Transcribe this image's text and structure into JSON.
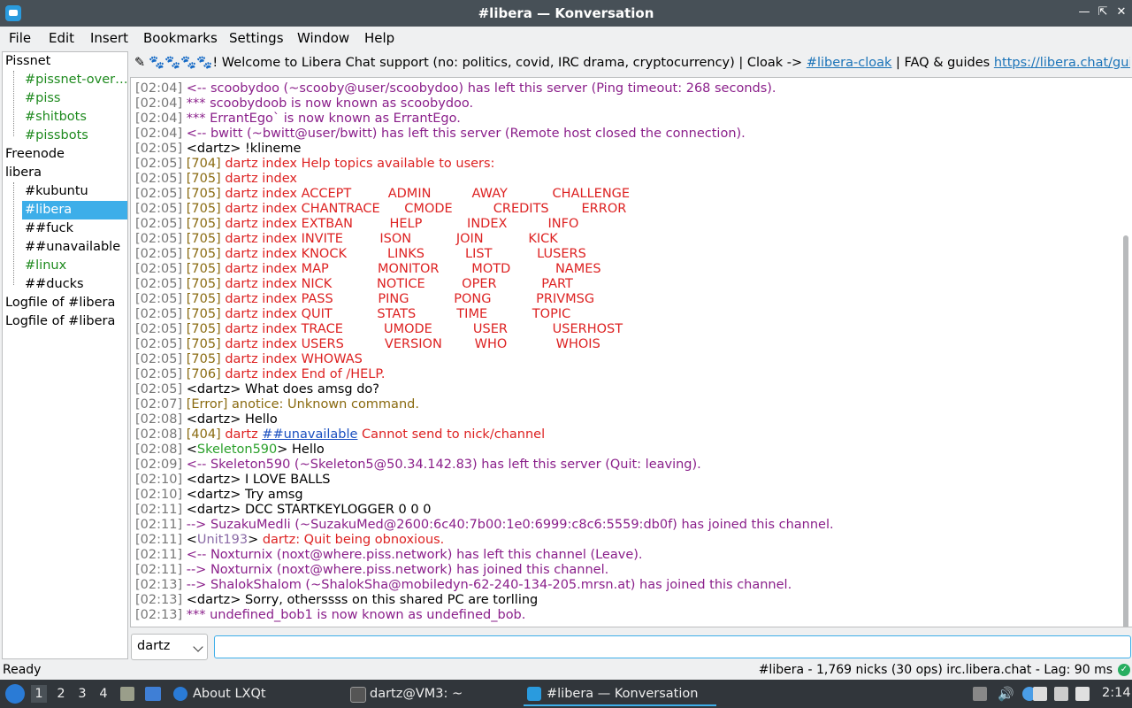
{
  "window": {
    "title": "#libera — Konversation",
    "controls": [
      "minimize-icon",
      "maximize-icon",
      "close-icon"
    ]
  },
  "menu": [
    "File",
    "Edit",
    "Insert",
    "Bookmarks",
    "Settings",
    "Window",
    "Help"
  ],
  "tree": {
    "items": [
      {
        "label": "Pissnet",
        "level": 0,
        "color": "black"
      },
      {
        "label": "#pissnet-overflow",
        "level": 1,
        "color": "green"
      },
      {
        "label": "#piss",
        "level": 1,
        "color": "green"
      },
      {
        "label": "#shitbots",
        "level": 1,
        "color": "green"
      },
      {
        "label": "#pissbots",
        "level": 1,
        "color": "green"
      },
      {
        "label": "Freenode",
        "level": 0,
        "color": "black"
      },
      {
        "label": "libera",
        "level": 0,
        "color": "black"
      },
      {
        "label": "#kubuntu",
        "level": 1,
        "color": "black"
      },
      {
        "label": "#libera",
        "level": 1,
        "color": "selected"
      },
      {
        "label": "##fuck",
        "level": 1,
        "color": "black"
      },
      {
        "label": "##unavailable",
        "level": 1,
        "color": "black"
      },
      {
        "label": "#linux",
        "level": 1,
        "color": "green"
      },
      {
        "label": "##ducks",
        "level": 1,
        "color": "black"
      },
      {
        "label": "Logfile of #libera",
        "level": 0,
        "color": "black"
      },
      {
        "label": "Logfile of #libera",
        "level": 0,
        "color": "black"
      }
    ]
  },
  "topic": {
    "emoji": "🐾🐾🐾🐾",
    "text_before": "! Welcome to Libera Chat support (no: politics, covid, IRC drama, cryptocurrency) | Cloak -> ",
    "link1": "#libera-cloak",
    "text_mid": " | FAQ & guides ",
    "link2": "https://libera.chat/guides/fa..."
  },
  "chat": [
    {
      "ts": "[02:04]",
      "segs": [
        {
          "t": "<-- scoobydoo (~scooby@user/scoobydoo) has left this server (Ping timeout: 268 seconds).",
          "c": "purple"
        }
      ]
    },
    {
      "ts": "[02:04]",
      "segs": [
        {
          "t": "*** scoobydoob is now known as scoobydoo.",
          "c": "purple"
        }
      ]
    },
    {
      "ts": "[02:04]",
      "segs": [
        {
          "t": "*** ErrantEgo` is now known as ErrantEgo.",
          "c": "purple"
        }
      ]
    },
    {
      "ts": "[02:04]",
      "segs": [
        {
          "t": "<-- bwitt (~bwitt@user/bwitt) has left this server (Remote host closed the connection).",
          "c": "purple"
        }
      ]
    },
    {
      "ts": "[02:05]",
      "segs": [
        {
          "t": "<dartz> !klineme",
          "c": "plain"
        }
      ]
    },
    {
      "ts": "[02:05]",
      "segs": [
        {
          "t": "[704]",
          "c": "brown"
        },
        {
          "t": " dartz index Help topics available to users:",
          "c": "red"
        }
      ]
    },
    {
      "ts": "[02:05]",
      "segs": [
        {
          "t": "[705]",
          "c": "brown"
        },
        {
          "t": " dartz index",
          "c": "red"
        }
      ]
    },
    {
      "ts": "[02:05]",
      "segs": [
        {
          "t": "[705]",
          "c": "brown"
        },
        {
          "t": " dartz index ACCEPT         ADMIN          AWAY           CHALLENGE",
          "c": "red"
        }
      ]
    },
    {
      "ts": "[02:05]",
      "segs": [
        {
          "t": "[705]",
          "c": "brown"
        },
        {
          "t": " dartz index CHANTRACE      CMODE          CREDITS        ERROR",
          "c": "red"
        }
      ]
    },
    {
      "ts": "[02:05]",
      "segs": [
        {
          "t": "[705]",
          "c": "brown"
        },
        {
          "t": " dartz index EXTBAN         HELP           INDEX          INFO",
          "c": "red"
        }
      ]
    },
    {
      "ts": "[02:05]",
      "segs": [
        {
          "t": "[705]",
          "c": "brown"
        },
        {
          "t": " dartz index INVITE         ISON           JOIN           KICK",
          "c": "red"
        }
      ]
    },
    {
      "ts": "[02:05]",
      "segs": [
        {
          "t": "[705]",
          "c": "brown"
        },
        {
          "t": " dartz index KNOCK          LINKS          LIST           LUSERS",
          "c": "red"
        }
      ]
    },
    {
      "ts": "[02:05]",
      "segs": [
        {
          "t": "[705]",
          "c": "brown"
        },
        {
          "t": " dartz index MAP            MONITOR        MOTD           NAMES",
          "c": "red"
        }
      ]
    },
    {
      "ts": "[02:05]",
      "segs": [
        {
          "t": "[705]",
          "c": "brown"
        },
        {
          "t": " dartz index NICK           NOTICE         OPER           PART",
          "c": "red"
        }
      ]
    },
    {
      "ts": "[02:05]",
      "segs": [
        {
          "t": "[705]",
          "c": "brown"
        },
        {
          "t": " dartz index PASS           PING           PONG           PRIVMSG",
          "c": "red"
        }
      ]
    },
    {
      "ts": "[02:05]",
      "segs": [
        {
          "t": "[705]",
          "c": "brown"
        },
        {
          "t": " dartz index QUIT           STATS          TIME           TOPIC",
          "c": "red"
        }
      ]
    },
    {
      "ts": "[02:05]",
      "segs": [
        {
          "t": "[705]",
          "c": "brown"
        },
        {
          "t": " dartz index TRACE          UMODE          USER           USERHOST",
          "c": "red"
        }
      ]
    },
    {
      "ts": "[02:05]",
      "segs": [
        {
          "t": "[705]",
          "c": "brown"
        },
        {
          "t": " dartz index USERS          VERSION        WHO            WHOIS",
          "c": "red"
        }
      ]
    },
    {
      "ts": "[02:05]",
      "segs": [
        {
          "t": "[705]",
          "c": "brown"
        },
        {
          "t": " dartz index WHOWAS",
          "c": "red"
        }
      ]
    },
    {
      "ts": "[02:05]",
      "segs": [
        {
          "t": "[706]",
          "c": "brown"
        },
        {
          "t": " dartz index End of /HELP.",
          "c": "red"
        }
      ]
    },
    {
      "ts": "[02:05]",
      "segs": [
        {
          "t": "<dartz> What does amsg do?",
          "c": "plain"
        }
      ]
    },
    {
      "ts": "[02:07]",
      "segs": [
        {
          "t": "[Error]",
          "c": "brown"
        },
        {
          "t": " anotice: Unknown command.",
          "c": "brown"
        }
      ]
    },
    {
      "ts": "[02:08]",
      "segs": [
        {
          "t": "<dartz> Hello",
          "c": "plain"
        }
      ]
    },
    {
      "ts": "[02:08]",
      "segs": [
        {
          "t": "[404]",
          "c": "brown"
        },
        {
          "t": " dartz ",
          "c": "red"
        },
        {
          "t": "##unavailable",
          "c": "link"
        },
        {
          "t": " Cannot send to nick/channel",
          "c": "red"
        }
      ]
    },
    {
      "ts": "[02:08]",
      "segs": [
        {
          "t": "<",
          "c": "plain"
        },
        {
          "t": "Skeleton590",
          "c": "green"
        },
        {
          "t": "> Hello",
          "c": "plain"
        }
      ]
    },
    {
      "ts": "[02:09]",
      "segs": [
        {
          "t": "<-- Skeleton590 (~Skeleton5@50.34.142.83) has left this server (Quit: leaving).",
          "c": "purple"
        }
      ]
    },
    {
      "ts": "[02:10]",
      "segs": [
        {
          "t": "<dartz> I LOVE BALLS",
          "c": "plain"
        }
      ]
    },
    {
      "ts": "[02:10]",
      "segs": [
        {
          "t": "<dartz> Try amsg",
          "c": "plain"
        }
      ]
    },
    {
      "ts": "[02:11]",
      "segs": [
        {
          "t": "<dartz> DCC STARTKEYLOGGER 0 0 0",
          "c": "plain"
        }
      ]
    },
    {
      "ts": "[02:11]",
      "segs": [
        {
          "t": "--> SuzakuMedli (~SuzakuMed@2600:6c40:7b00:1e0:6999:c8c6:5559:db0f) has joined this channel.",
          "c": "purple"
        }
      ]
    },
    {
      "ts": "[02:11]",
      "segs": [
        {
          "t": "<",
          "c": "plain"
        },
        {
          "t": "Unit193",
          "c": "lav"
        },
        {
          "t": "> ",
          "c": "plain"
        },
        {
          "t": "dartz: Quit being obnoxious.",
          "c": "red"
        }
      ]
    },
    {
      "ts": "[02:11]",
      "segs": [
        {
          "t": "<-- Noxturnix (noxt@where.piss.network) has left this channel (Leave).",
          "c": "purple"
        }
      ]
    },
    {
      "ts": "[02:11]",
      "segs": [
        {
          "t": "--> Noxturnix (noxt@where.piss.network) has joined this channel.",
          "c": "purple"
        }
      ]
    },
    {
      "ts": "[02:13]",
      "segs": [
        {
          "t": "--> ShalokShalom (~ShalokSha@mobiledyn-62-240-134-205.mrsn.at) has joined this channel.",
          "c": "purple"
        }
      ]
    },
    {
      "ts": "[02:13]",
      "segs": [
        {
          "t": "<dartz> Sorry, otherssss on this shared PC are torlling",
          "c": "plain"
        }
      ]
    },
    {
      "ts": "[02:13]",
      "segs": [
        {
          "t": "*** undefined_bob1 is now known as undefined_bob.",
          "c": "purple"
        }
      ]
    }
  ],
  "nick_selector": {
    "value": "dartz"
  },
  "message_input": {
    "value": ""
  },
  "status": {
    "left": "Ready",
    "right": "#libera - 1,769 nicks (30 ops)  irc.libera.chat - Lag: 90 ms"
  },
  "taskbar": {
    "workspaces": [
      "1",
      "2",
      "3",
      "4"
    ],
    "tasks": [
      {
        "label": "About LXQt",
        "active": false
      },
      {
        "label": "dartz@VM3: ~",
        "active": false
      },
      {
        "label": "#libera — Konversation",
        "active": true
      }
    ],
    "clock": "2:14"
  },
  "colors": {
    "purple": "#8a1f8a",
    "red": "#dd2222",
    "brown": "#8a6a10",
    "green": "#2aa02a",
    "lav": "#8a6aa6",
    "link": "#1a4fc0",
    "plain": "#000000",
    "selection": "#3daee9"
  }
}
